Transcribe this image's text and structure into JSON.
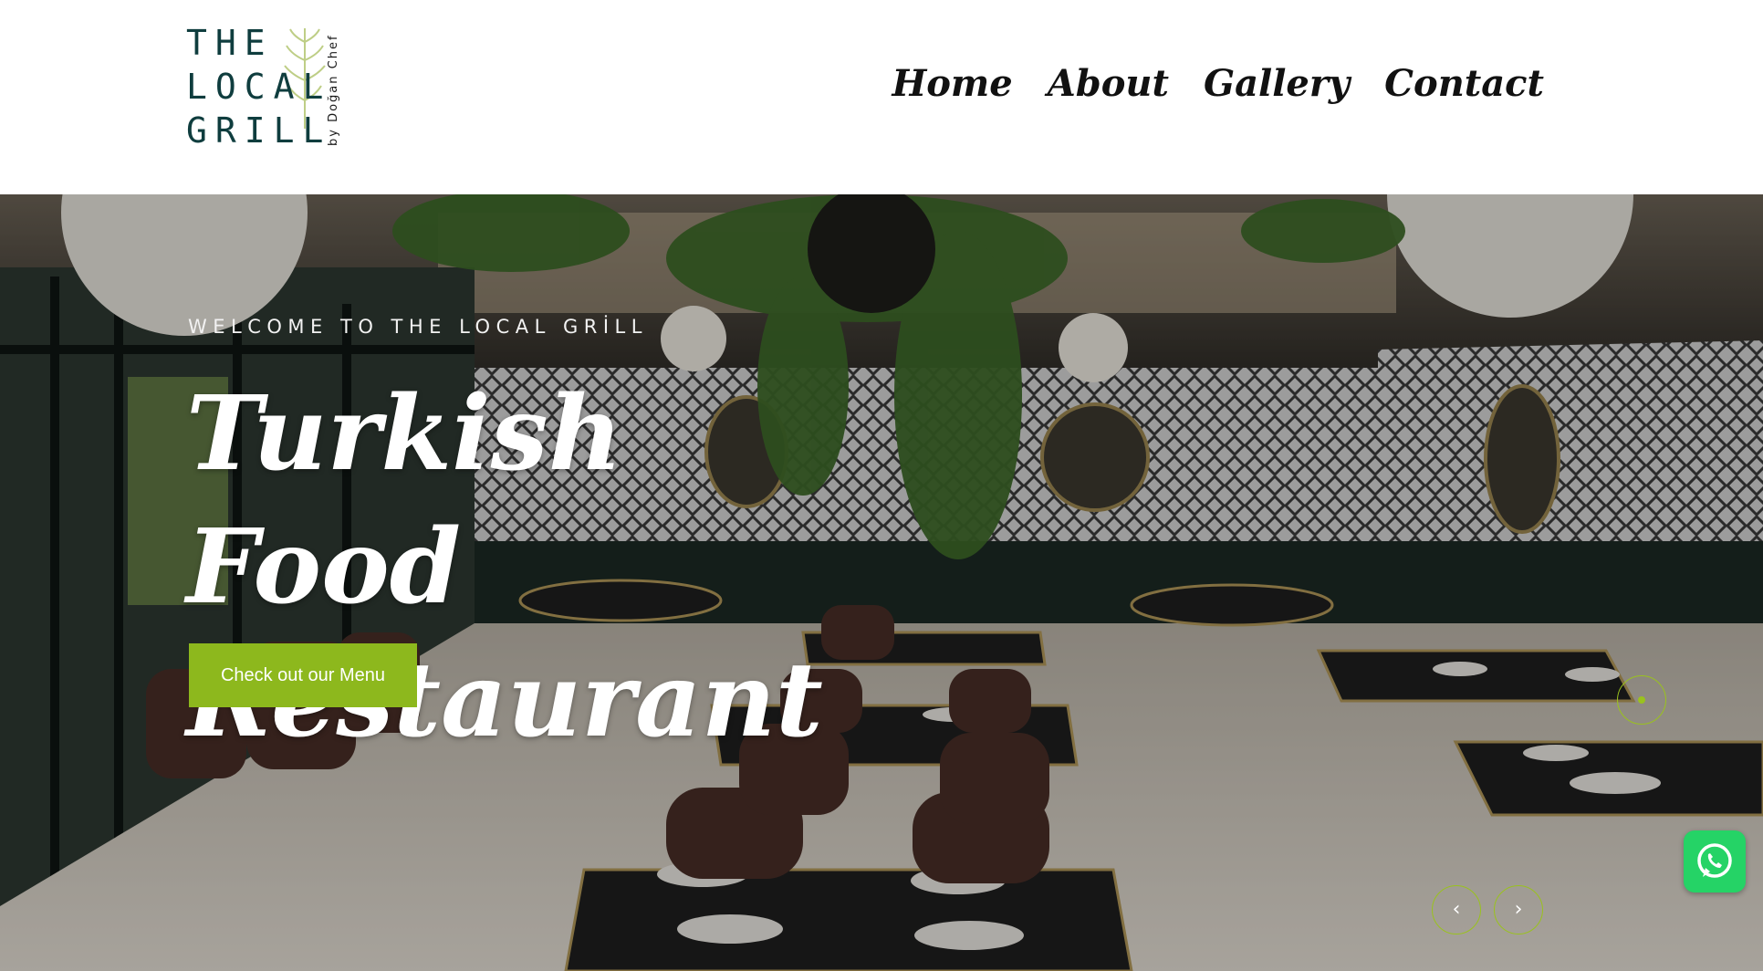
{
  "header": {
    "logo": {
      "line1": "THE",
      "line2": "LOCAL",
      "line3": "GRILL",
      "byline": "by Doğan Chef"
    },
    "nav": [
      "Home",
      "About",
      "Gallery",
      "Contact"
    ]
  },
  "hero": {
    "welcome": "WELCOME TO THE LOCAL GRİLL",
    "headline": "Turkish Food Restaurant",
    "cta_label": "Check out our Menu",
    "prev_icon": "chevron-left-icon",
    "next_icon": "chevron-right-icon",
    "prev_glyph": "‹",
    "next_glyph": "›"
  },
  "colors": {
    "accent": "#8db81d",
    "logo": "#0f3d3e",
    "whatsapp": "#25d366"
  },
  "widgets": {
    "whatsapp_icon": "whatsapp-icon",
    "slider_indicator": "slide-dot"
  }
}
